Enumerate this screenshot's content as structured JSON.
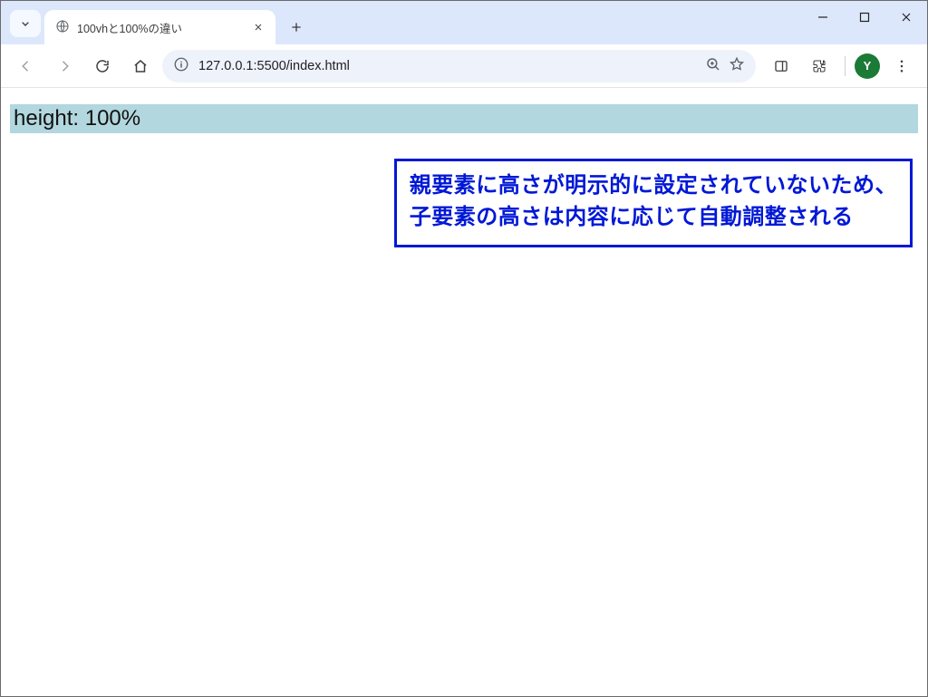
{
  "window": {
    "tab_title": "100vhと100%の違い",
    "avatar_letter": "Y"
  },
  "address_bar": {
    "url": "127.0.0.1:5500/index.html"
  },
  "page": {
    "box_text": "height: 100%",
    "annotation_line1": "親要素に高さが明示的に設定されていないため、",
    "annotation_line2": "子要素の高さは内容に応じて自動調整される"
  }
}
